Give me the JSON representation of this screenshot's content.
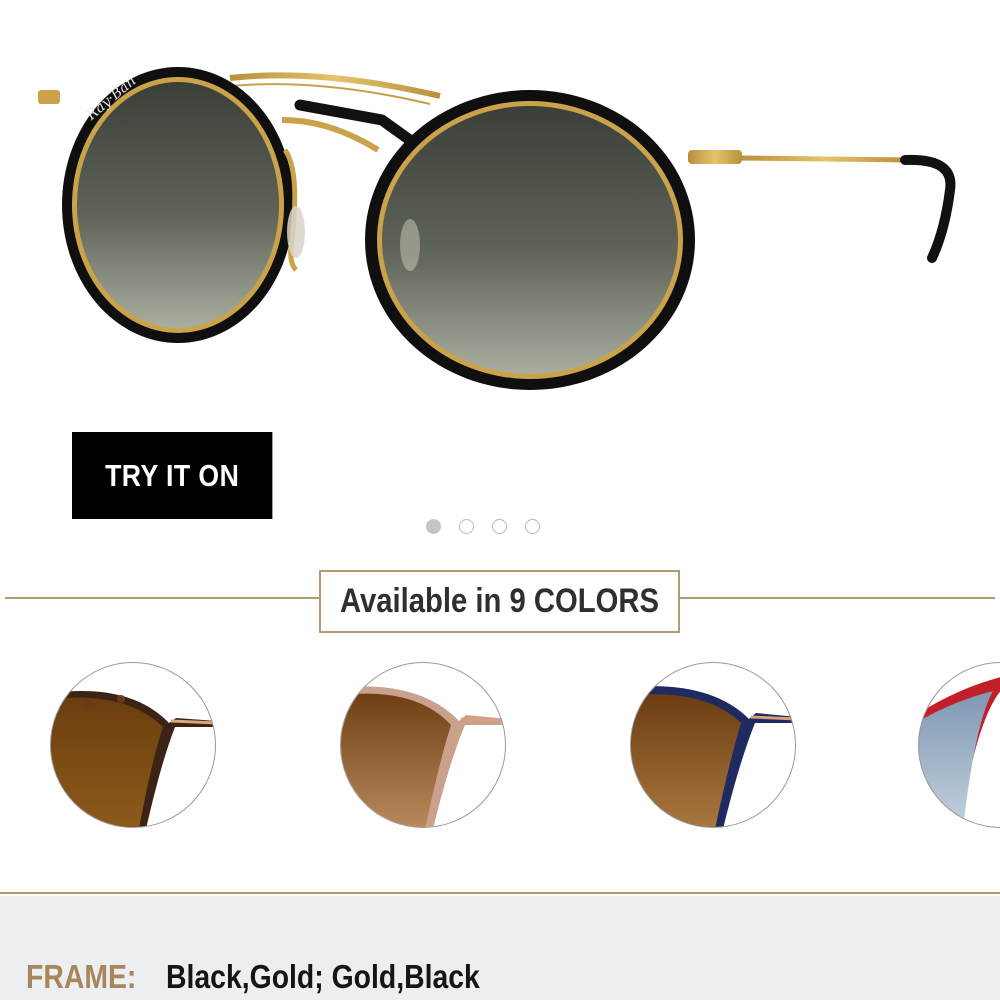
{
  "product": {
    "image_alt": "Round black and gold sunglasses with grey gradient lenses",
    "brand_mark": "Ray-Ban"
  },
  "try_on": {
    "label": "TRY IT ON"
  },
  "carousel": {
    "slides": 4,
    "active_index": 0
  },
  "colors": {
    "title": "Available in 9 COLORS",
    "swatches": [
      {
        "name": "tortoise-brown-swatch",
        "frame": "#3b2316",
        "lens": "#7a4a12",
        "temple": "#d9a77e"
      },
      {
        "name": "pink-brown-swatch",
        "frame": "#caa18c",
        "lens": "#8a5722",
        "temple": "#d9a07c"
      },
      {
        "name": "blue-brown-swatch",
        "frame": "#1f2a60",
        "lens": "#7d4e1c",
        "temple": "#d7a07b"
      },
      {
        "name": "red-blue-swatch",
        "frame": "#c21f2b",
        "lens": "#9fb4c6",
        "temple": "#c21f2b"
      }
    ]
  },
  "specs": {
    "frame_label": "FRAME:",
    "frame_value": "Black,Gold; Gold,Black"
  },
  "colors_theme": {
    "gold_rule": "#b19b6f",
    "label_gold": "#a7865a",
    "specs_bg": "#eceef2"
  }
}
